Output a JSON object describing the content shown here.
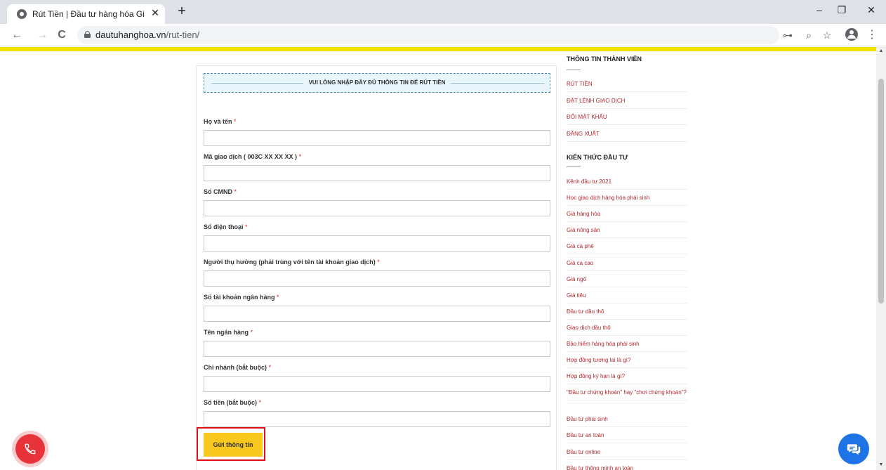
{
  "browser": {
    "tab_title": "Rút Tiền | Đầu tư hàng hóa Gia C",
    "tab_close": "✕",
    "new_tab": "+",
    "url_domain": "dautuhanghoa.vn",
    "url_path": "/rut-tien/",
    "back": "←",
    "forward": "→",
    "reload": "C",
    "key_icon": "⊶",
    "zoom_icon": "⌕",
    "star_icon": "☆",
    "menu_icon": "⋮",
    "minimize": "–",
    "restore": "❐",
    "close": "✕"
  },
  "form": {
    "notice": "VUI LÒNG NHẬP ĐẦY ĐỦ THÔNG TIN ĐỂ RÚT TIỀN",
    "required_mark": "*",
    "fields": [
      {
        "label": "Họ và tên",
        "value": ""
      },
      {
        "label": "Mã giao dịch ( 003C XX XX XX )",
        "value": ""
      },
      {
        "label": "Số CMND",
        "value": ""
      },
      {
        "label": "Số điện thoại",
        "value": ""
      },
      {
        "label": "Người thụ hưởng (phải trùng với tên tài khoản giao dịch)",
        "value": ""
      },
      {
        "label": "Số tài khoản ngân hàng",
        "value": ""
      },
      {
        "label": "Tên ngân hàng",
        "value": ""
      },
      {
        "label": "Chi nhánh (bắt buộc)",
        "value": ""
      },
      {
        "label": "Số tiền (bắt buộc)",
        "value": ""
      }
    ],
    "submit_label": "Gửi thông tin"
  },
  "sidebar": {
    "member_heading": "THÔNG TIN THÀNH VIÊN",
    "member_items": [
      "RÚT TIỀN",
      "ĐẶT LỆNH GIAO DỊCH",
      "ĐỔI MẬT KHẨU",
      "ĐĂNG XUẤT"
    ],
    "knowledge_heading": "KIẾN THỨC ĐẦU TƯ",
    "knowledge_items": [
      "Kênh đầu tư 2021",
      "Học giao dịch hàng hóa phái sinh",
      "Giá hàng hóa",
      "Giá nông sản",
      "Giá cà phê",
      "Giá ca cao",
      "Giá ngô",
      "Giá tiêu",
      "Đầu tư dầu thô",
      "Giao dịch dầu thô",
      "Bảo hiểm hàng hóa phái sinh",
      "Hợp đồng tương lai là gì?",
      "Hợp đồng kỳ hạn là gì?",
      "\"Đầu tư chứng khoán\" hay \"chơi chứng khoán\"?",
      "Đầu tư phái sinh",
      "Đầu tư an toàn",
      "Đầu tư online",
      "Đầu tư thông minh an toàn"
    ]
  },
  "colors": {
    "accent_yellow": "#f5e100",
    "button_yellow": "#f8c81e",
    "link_red": "#b2282d",
    "highlight_red": "#e0101a",
    "chat_blue": "#1e74e6",
    "phone_red": "#e8333a"
  }
}
